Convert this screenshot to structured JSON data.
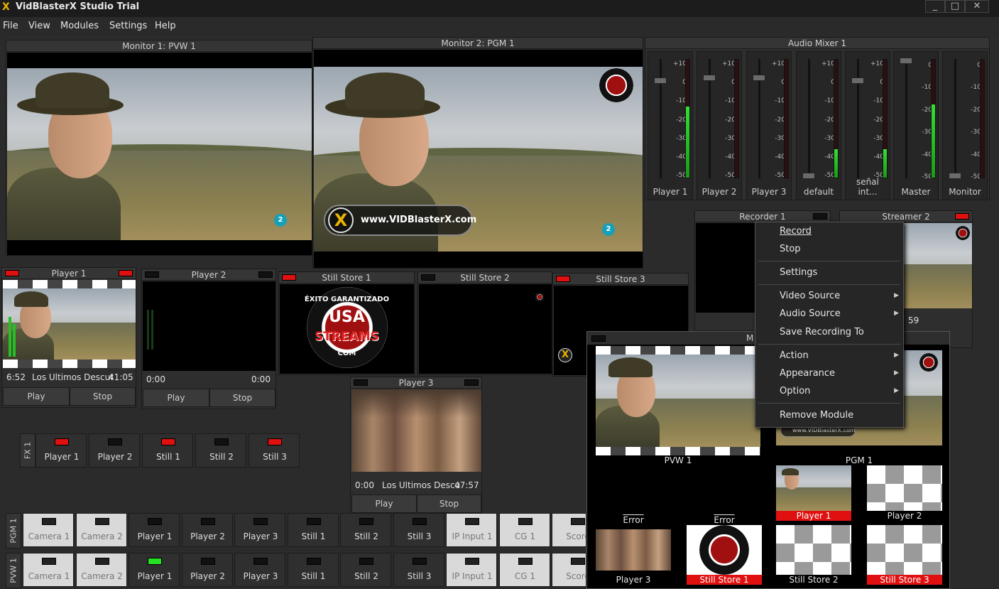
{
  "app": {
    "title": "VidBlasterX Studio Trial",
    "logo": "X",
    "win_min": "_",
    "win_max": "□",
    "win_close": "✕"
  },
  "menu": [
    "File",
    "View",
    "Modules",
    "Settings",
    "Help"
  ],
  "monitor1": {
    "title": "Monitor 1: PVW 1",
    "ip_badge": "2"
  },
  "monitor2": {
    "title": "Monitor 2: PGM 1",
    "ip_badge": "2",
    "watermark": "www.VIDBlasterX.com"
  },
  "audio_mixer": {
    "title": "Audio Mixer 1",
    "scale": [
      "+10",
      "0",
      "-10",
      "-20",
      "-30",
      "-40",
      "-50"
    ],
    "scale_master": [
      "0",
      "-10",
      "-20",
      "-30",
      "-40",
      "-50"
    ],
    "channels": [
      {
        "name": "Player 1",
        "level": 0.6
      },
      {
        "name": "Player 2",
        "level": 0.0
      },
      {
        "name": "Player 3",
        "level": 0.0
      },
      {
        "name": "default",
        "level": 0.24
      },
      {
        "name": "señal int...",
        "level": 0.24
      },
      {
        "name": "Master",
        "level": 0.62
      },
      {
        "name": "Monitor",
        "level": 0.0
      }
    ]
  },
  "player1": {
    "title": "Player 1",
    "time": "6:52",
    "clip": "Los Ultimos Descut",
    "duration": "41:05",
    "play": "Play",
    "stop": "Stop"
  },
  "player2": {
    "title": "Player 2",
    "time": "0:00",
    "duration": "0:00",
    "play": "Play",
    "stop": "Stop"
  },
  "player3": {
    "title": "Player 3",
    "time": "0:00",
    "clip": "Los Ultimos Descu",
    "duration": "47:57",
    "play": "Play",
    "stop": "Stop"
  },
  "still1": {
    "title": "Still Store 1"
  },
  "still2": {
    "title": "Still Store 2"
  },
  "still3": {
    "title": "Still Store 3"
  },
  "recorder": {
    "title": "Recorder 1"
  },
  "streamer": {
    "title": "Streamer 2",
    "time": "59"
  },
  "logo_seal": {
    "top": "ÉXITO GARANTIZADO",
    "mid": "USA",
    "main": "STREAMS",
    "bottom": "COM"
  },
  "fx": {
    "label": "FX 1",
    "buttons": [
      {
        "label": "Player 1",
        "ind": "red"
      },
      {
        "label": "Player 2",
        "ind": "off"
      },
      {
        "label": "Still 1",
        "ind": "red"
      },
      {
        "label": "Still 2",
        "ind": "off"
      },
      {
        "label": "Still 3",
        "ind": "red"
      }
    ]
  },
  "pgm_row": {
    "label": "PGM 1",
    "buttons": [
      {
        "label": "Camera 1",
        "style": "light",
        "ind": "off"
      },
      {
        "label": "Camera 2",
        "style": "light",
        "ind": "off"
      },
      {
        "label": "Player 1",
        "style": "dark",
        "ind": "off"
      },
      {
        "label": "Player 2",
        "style": "dark",
        "ind": "off"
      },
      {
        "label": "Player 3",
        "style": "dark",
        "ind": "off"
      },
      {
        "label": "Still 1",
        "style": "dark",
        "ind": "off"
      },
      {
        "label": "Still 2",
        "style": "dark",
        "ind": "off"
      },
      {
        "label": "Still 3",
        "style": "dark",
        "ind": "off"
      },
      {
        "label": "IP Input 1",
        "style": "light",
        "ind": "off"
      },
      {
        "label": "CG 1",
        "style": "light",
        "ind": "off"
      },
      {
        "label": "Score",
        "style": "light",
        "ind": "off"
      }
    ]
  },
  "pvw_row": {
    "label": "PVW 1",
    "buttons": [
      {
        "label": "Camera 1",
        "style": "light",
        "ind": "off"
      },
      {
        "label": "Camera 2",
        "style": "light",
        "ind": "off"
      },
      {
        "label": "Player 1",
        "style": "dark",
        "ind": "green"
      },
      {
        "label": "Player 2",
        "style": "dark",
        "ind": "off"
      },
      {
        "label": "Player 3",
        "style": "dark",
        "ind": "off"
      },
      {
        "label": "Still 1",
        "style": "dark",
        "ind": "off"
      },
      {
        "label": "Still 2",
        "style": "dark",
        "ind": "off"
      },
      {
        "label": "Still 3",
        "style": "dark",
        "ind": "off"
      },
      {
        "label": "IP Input 1",
        "style": "light",
        "ind": "off"
      },
      {
        "label": "CG 1",
        "style": "light",
        "ind": "off"
      },
      {
        "label": "Score",
        "style": "light",
        "ind": "off"
      }
    ]
  },
  "multiview": {
    "title": "M",
    "pvw": "PVW 1",
    "pgm": "PGM 1",
    "error1": "Error",
    "error2": "Error",
    "tiles": [
      "Player 1",
      "Player 2",
      "Player 3",
      "Still Store 1",
      "Still Store 2",
      "Still Store 3"
    ],
    "watermark": "www.VIDBlasterX.com"
  },
  "context_menu": {
    "record": "Record",
    "stop": "Stop",
    "settings": "Settings",
    "video_source": "Video Source",
    "audio_source": "Audio Source",
    "save_recording": "Save Recording To",
    "action": "Action",
    "appearance": "Appearance",
    "option": "Option",
    "remove": "Remove Module",
    "arrow": "▶"
  }
}
